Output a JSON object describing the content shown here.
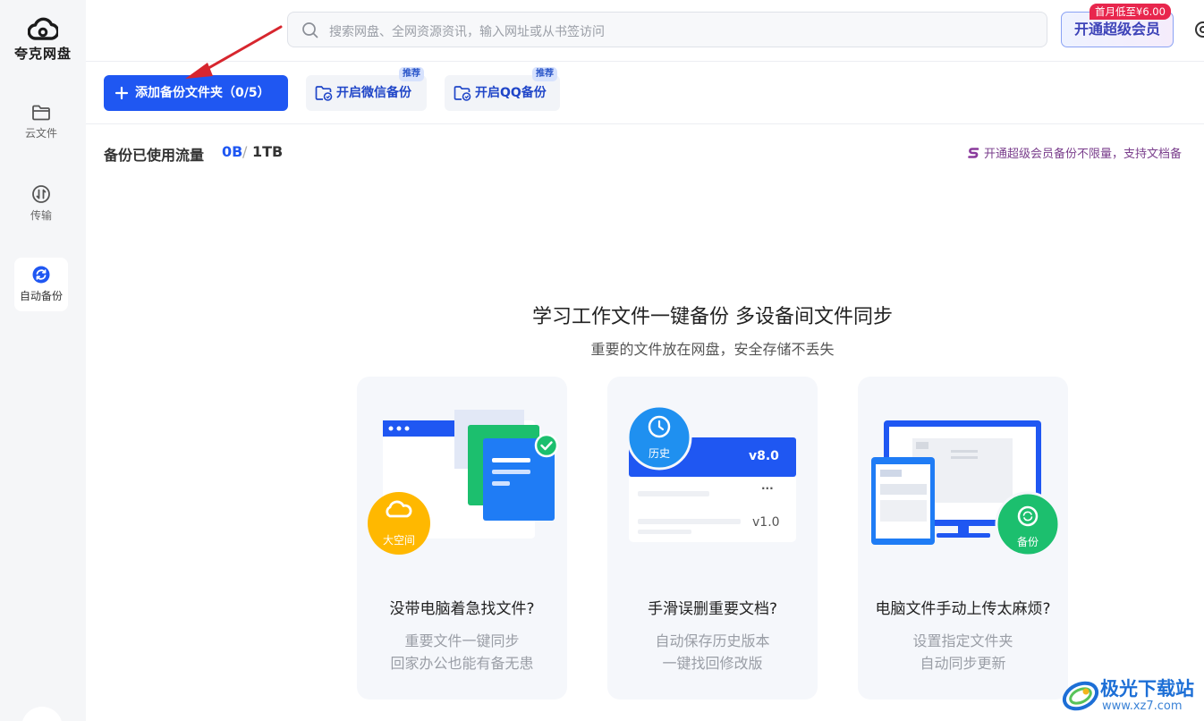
{
  "app": {
    "name": "夸克网盘"
  },
  "sidebar": {
    "items": [
      {
        "label": "云文件",
        "icon": "folder-icon"
      },
      {
        "label": "传输",
        "icon": "transfer-icon"
      },
      {
        "label": "自动备份",
        "icon": "backup-icon",
        "active": true
      }
    ]
  },
  "header": {
    "search_placeholder": "搜索网盘、全网资源资讯，输入网址或从书签访问",
    "vip_button": "开通超级会员",
    "vip_badge": "首月低至¥6.00"
  },
  "toolbar": {
    "add_folder": "添加备份文件夹（0/5）",
    "wechat_backup": "开启微信备份",
    "qq_backup": "开启QQ备份",
    "recommend_tag": "推荐"
  },
  "usage": {
    "label": "备份已使用流量",
    "used": "0B",
    "separator": "/",
    "total": "1TB",
    "promo": "开通超级会员备份不限量，支持文档备"
  },
  "hero": {
    "title": "学习工作文件一键备份 多设备间文件同步",
    "subtitle": "重要的文件放在网盘，安全存储不丢失"
  },
  "cards": [
    {
      "title": "没带电脑着急找文件?",
      "line1": "重要文件一键同步",
      "line2": "回家办公也能有备无患",
      "badge": "大空间"
    },
    {
      "title": "手滑误删重要文档?",
      "line1": "自动保存历史版本",
      "line2": "一键找回修改版",
      "badge": "历史",
      "version_new": "v8.0",
      "version_old": "v1.0",
      "more": "···"
    },
    {
      "title": "电脑文件手动上传太麻烦?",
      "line1": "设置指定文件夹",
      "line2": "自动同步更新",
      "badge": "备份"
    }
  ],
  "watermark": {
    "title": "极光下载站",
    "url": "www.xz7.com"
  },
  "colors": {
    "primary": "#1f57f2",
    "vip_badge": "#e8264d",
    "green": "#1cbf6e",
    "orange": "#ffb800"
  }
}
